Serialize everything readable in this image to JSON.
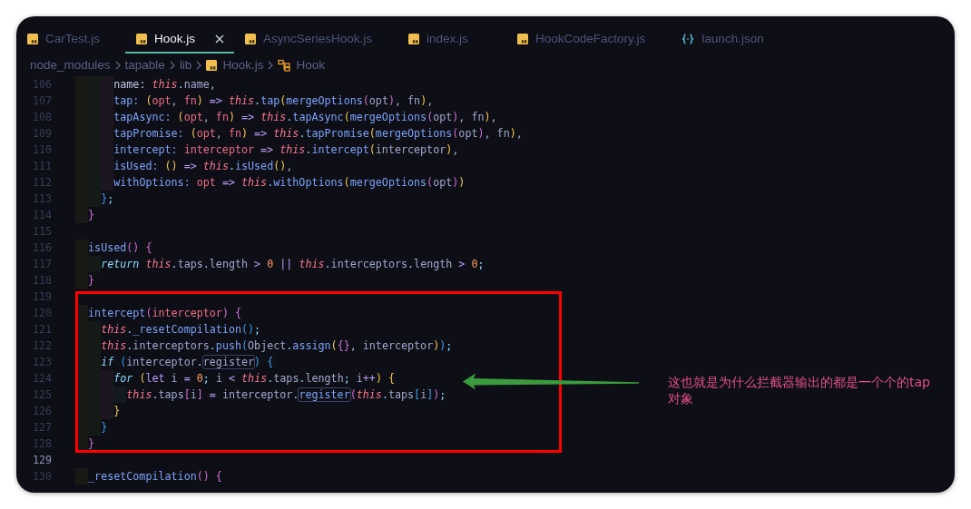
{
  "tabs": [
    {
      "label": "CarTest.js",
      "kind": "js",
      "selected": false
    },
    {
      "label": "Hook.js",
      "kind": "js",
      "selected": true
    },
    {
      "label": "AsyncSeriesHook.js",
      "kind": "js",
      "selected": false
    },
    {
      "label": "index.js",
      "kind": "js",
      "selected": false
    },
    {
      "label": "HookCodeFactory.js",
      "kind": "js",
      "selected": false
    },
    {
      "label": "launch.json",
      "kind": "json",
      "selected": false
    }
  ],
  "breadcrumb": [
    {
      "label": "node_modules",
      "kind": "folder"
    },
    {
      "label": "tapable",
      "kind": "folder"
    },
    {
      "label": "lib",
      "kind": "folder"
    },
    {
      "label": "Hook.js",
      "kind": "file"
    },
    {
      "label": "Hook",
      "kind": "symbol"
    }
  ],
  "editor": {
    "lines": [
      {
        "number": "106",
        "current": false,
        "tokens": [
          {
            "text": "      name: ",
            "kind": "key"
          },
          {
            "text": "this",
            "kind": "this"
          },
          {
            "text": ".",
            "kind": "punct"
          },
          {
            "text": "name,",
            "kind": "plain"
          }
        ]
      },
      {
        "number": "107",
        "current": false,
        "tokens": [
          {
            "text": "      tap: ",
            "kind": "func"
          },
          {
            "text": "(",
            "kind": "b1"
          },
          {
            "text": "opt",
            "kind": "param"
          },
          {
            "text": ", ",
            "kind": "plain"
          },
          {
            "text": "fn",
            "kind": "param"
          },
          {
            "text": ")",
            "kind": "b1"
          },
          {
            "text": " => ",
            "kind": "op"
          },
          {
            "text": "this",
            "kind": "this"
          },
          {
            "text": ".",
            "kind": "punct"
          },
          {
            "text": "tap",
            "kind": "func"
          },
          {
            "text": "(",
            "kind": "b1"
          },
          {
            "text": "mergeOptions",
            "kind": "func"
          },
          {
            "text": "(",
            "kind": "b2"
          },
          {
            "text": "opt",
            "kind": "plain"
          },
          {
            "text": ")",
            "kind": "b2"
          },
          {
            "text": ", fn",
            "kind": "plain"
          },
          {
            "text": ")",
            "kind": "b1"
          },
          {
            "text": ",",
            "kind": "plain"
          }
        ]
      },
      {
        "number": "108",
        "current": false,
        "tokens": [
          {
            "text": "      tapAsync: ",
            "kind": "func"
          },
          {
            "text": "(",
            "kind": "b1"
          },
          {
            "text": "opt",
            "kind": "param"
          },
          {
            "text": ", ",
            "kind": "plain"
          },
          {
            "text": "fn",
            "kind": "param"
          },
          {
            "text": ")",
            "kind": "b1"
          },
          {
            "text": " => ",
            "kind": "op"
          },
          {
            "text": "this",
            "kind": "this"
          },
          {
            "text": ".",
            "kind": "punct"
          },
          {
            "text": "tapAsync",
            "kind": "func"
          },
          {
            "text": "(",
            "kind": "b1"
          },
          {
            "text": "mergeOptions",
            "kind": "func"
          },
          {
            "text": "(",
            "kind": "b2"
          },
          {
            "text": "opt",
            "kind": "plain"
          },
          {
            "text": ")",
            "kind": "b2"
          },
          {
            "text": ", fn",
            "kind": "plain"
          },
          {
            "text": ")",
            "kind": "b1"
          },
          {
            "text": ",",
            "kind": "plain"
          }
        ]
      },
      {
        "number": "109",
        "current": false,
        "tokens": [
          {
            "text": "      tapPromise: ",
            "kind": "func"
          },
          {
            "text": "(",
            "kind": "b1"
          },
          {
            "text": "opt",
            "kind": "param"
          },
          {
            "text": ", ",
            "kind": "plain"
          },
          {
            "text": "fn",
            "kind": "param"
          },
          {
            "text": ")",
            "kind": "b1"
          },
          {
            "text": " => ",
            "kind": "op"
          },
          {
            "text": "this",
            "kind": "this"
          },
          {
            "text": ".",
            "kind": "punct"
          },
          {
            "text": "tapPromise",
            "kind": "func"
          },
          {
            "text": "(",
            "kind": "b1"
          },
          {
            "text": "mergeOptions",
            "kind": "func"
          },
          {
            "text": "(",
            "kind": "b2"
          },
          {
            "text": "opt",
            "kind": "plain"
          },
          {
            "text": ")",
            "kind": "b2"
          },
          {
            "text": ", fn",
            "kind": "plain"
          },
          {
            "text": ")",
            "kind": "b1"
          },
          {
            "text": ",",
            "kind": "plain"
          }
        ]
      },
      {
        "number": "110",
        "current": false,
        "tokens": [
          {
            "text": "      intercept: ",
            "kind": "func"
          },
          {
            "text": "interceptor",
            "kind": "param"
          },
          {
            "text": " => ",
            "kind": "op"
          },
          {
            "text": "this",
            "kind": "this"
          },
          {
            "text": ".",
            "kind": "punct"
          },
          {
            "text": "intercept",
            "kind": "func"
          },
          {
            "text": "(",
            "kind": "b1"
          },
          {
            "text": "interceptor",
            "kind": "plain"
          },
          {
            "text": ")",
            "kind": "b1"
          },
          {
            "text": ",",
            "kind": "plain"
          }
        ]
      },
      {
        "number": "111",
        "current": false,
        "tokens": [
          {
            "text": "      isUsed: ",
            "kind": "func"
          },
          {
            "text": "()",
            "kind": "b1"
          },
          {
            "text": " => ",
            "kind": "op"
          },
          {
            "text": "this",
            "kind": "this"
          },
          {
            "text": ".",
            "kind": "punct"
          },
          {
            "text": "isUsed",
            "kind": "func"
          },
          {
            "text": "()",
            "kind": "b1"
          },
          {
            "text": ",",
            "kind": "plain"
          }
        ]
      },
      {
        "number": "112",
        "current": false,
        "tokens": [
          {
            "text": "      withOptions: ",
            "kind": "func"
          },
          {
            "text": "opt",
            "kind": "param"
          },
          {
            "text": " => ",
            "kind": "op"
          },
          {
            "text": "this",
            "kind": "this"
          },
          {
            "text": ".",
            "kind": "punct"
          },
          {
            "text": "withOptions",
            "kind": "func"
          },
          {
            "text": "(",
            "kind": "b1"
          },
          {
            "text": "mergeOptions",
            "kind": "func"
          },
          {
            "text": "(",
            "kind": "b2"
          },
          {
            "text": "opt",
            "kind": "plain"
          },
          {
            "text": ")",
            "kind": "b2"
          },
          {
            "text": ")",
            "kind": "b1"
          }
        ]
      },
      {
        "number": "113",
        "current": false,
        "tokens": [
          {
            "text": "    }",
            "kind": "b3"
          },
          {
            "text": ";",
            "kind": "punct"
          }
        ]
      },
      {
        "number": "114",
        "current": false,
        "tokens": [
          {
            "text": "  }",
            "kind": "b2"
          }
        ]
      },
      {
        "number": "115",
        "current": false
      },
      {
        "number": "116",
        "current": false,
        "tokens": [
          {
            "text": "  isUsed",
            "kind": "func"
          },
          {
            "text": "() {",
            "kind": "b2"
          }
        ]
      },
      {
        "number": "117",
        "current": false,
        "tokens": [
          {
            "text": "    return ",
            "kind": "kw"
          },
          {
            "text": "this",
            "kind": "this"
          },
          {
            "text": ".",
            "kind": "punct"
          },
          {
            "text": "taps",
            "kind": "plain"
          },
          {
            "text": ".",
            "kind": "punct"
          },
          {
            "text": "length",
            "kind": "plain"
          },
          {
            "text": " > ",
            "kind": "op"
          },
          {
            "text": "0",
            "kind": "num"
          },
          {
            "text": " || ",
            "kind": "op"
          },
          {
            "text": "this",
            "kind": "this"
          },
          {
            "text": ".",
            "kind": "punct"
          },
          {
            "text": "interceptors",
            "kind": "plain"
          },
          {
            "text": ".",
            "kind": "punct"
          },
          {
            "text": "length",
            "kind": "plain"
          },
          {
            "text": " > ",
            "kind": "op"
          },
          {
            "text": "0",
            "kind": "num"
          },
          {
            "text": ";",
            "kind": "punct"
          }
        ]
      },
      {
        "number": "118",
        "current": false,
        "tokens": [
          {
            "text": "  }",
            "kind": "b2"
          }
        ]
      },
      {
        "number": "119",
        "current": false
      },
      {
        "number": "120",
        "current": false,
        "tokens": [
          {
            "text": "  intercept",
            "kind": "func"
          },
          {
            "text": "(",
            "kind": "b2"
          },
          {
            "text": "interceptor",
            "kind": "param"
          },
          {
            "text": ") {",
            "kind": "b2"
          }
        ]
      },
      {
        "number": "121",
        "current": false,
        "tokens": [
          {
            "text": "    this",
            "kind": "this"
          },
          {
            "text": ".",
            "kind": "punct"
          },
          {
            "text": "_resetCompilation",
            "kind": "func"
          },
          {
            "text": "()",
            "kind": "b3"
          },
          {
            "text": ";",
            "kind": "punct"
          }
        ]
      },
      {
        "number": "122",
        "current": false,
        "tokens": [
          {
            "text": "    this",
            "kind": "this"
          },
          {
            "text": ".",
            "kind": "punct"
          },
          {
            "text": "interceptors",
            "kind": "plain"
          },
          {
            "text": ".",
            "kind": "punct"
          },
          {
            "text": "push",
            "kind": "func"
          },
          {
            "text": "(",
            "kind": "b3"
          },
          {
            "text": "Object",
            "kind": "plain"
          },
          {
            "text": ".",
            "kind": "punct"
          },
          {
            "text": "assign",
            "kind": "func"
          },
          {
            "text": "(",
            "kind": "b1"
          },
          {
            "text": "{}",
            "kind": "b2"
          },
          {
            "text": ", interceptor",
            "kind": "plain"
          },
          {
            "text": ")",
            "kind": "b1"
          },
          {
            "text": ")",
            "kind": "b3"
          },
          {
            "text": ";",
            "kind": "punct"
          }
        ]
      },
      {
        "number": "123",
        "current": false,
        "tokens": [
          {
            "text": "    if ",
            "kind": "kw"
          },
          {
            "text": "(",
            "kind": "b3"
          },
          {
            "text": "interceptor",
            "kind": "plain"
          },
          {
            "text": ".",
            "kind": "punct"
          },
          {
            "text": "register",
            "kind": "match_plain"
          },
          {
            "text": ") {",
            "kind": "b3"
          }
        ]
      },
      {
        "number": "124",
        "current": false,
        "tokens": [
          {
            "text": "      for ",
            "kind": "kw"
          },
          {
            "text": "(",
            "kind": "b1"
          },
          {
            "text": "let",
            "kind": "storage"
          },
          {
            "text": " i",
            "kind": "plain"
          },
          {
            "text": " = ",
            "kind": "op"
          },
          {
            "text": "0",
            "kind": "num"
          },
          {
            "text": ";",
            "kind": "punct"
          },
          {
            "text": " i",
            "kind": "plain"
          },
          {
            "text": " < ",
            "kind": "op"
          },
          {
            "text": "this",
            "kind": "this"
          },
          {
            "text": ".",
            "kind": "punct"
          },
          {
            "text": "taps",
            "kind": "plain"
          },
          {
            "text": ".",
            "kind": "punct"
          },
          {
            "text": "length",
            "kind": "plain"
          },
          {
            "text": ";",
            "kind": "punct"
          },
          {
            "text": " i",
            "kind": "plain"
          },
          {
            "text": "++",
            "kind": "op"
          },
          {
            "text": ") {",
            "kind": "b1"
          }
        ]
      },
      {
        "number": "125",
        "current": false,
        "tokens": [
          {
            "text": "        this",
            "kind": "this"
          },
          {
            "text": ".",
            "kind": "punct"
          },
          {
            "text": "taps",
            "kind": "plain"
          },
          {
            "text": "[",
            "kind": "b2"
          },
          {
            "text": "i",
            "kind": "plain"
          },
          {
            "text": "]",
            "kind": "b2"
          },
          {
            "text": " = ",
            "kind": "op"
          },
          {
            "text": "interceptor",
            "kind": "plain"
          },
          {
            "text": ".",
            "kind": "punct"
          },
          {
            "text": "register",
            "kind": "match_func"
          },
          {
            "text": "(",
            "kind": "b2"
          },
          {
            "text": "this",
            "kind": "this"
          },
          {
            "text": ".",
            "kind": "punct"
          },
          {
            "text": "taps",
            "kind": "plain"
          },
          {
            "text": "[",
            "kind": "b3"
          },
          {
            "text": "i",
            "kind": "plain"
          },
          {
            "text": "]",
            "kind": "b3"
          },
          {
            "text": ")",
            "kind": "b2"
          },
          {
            "text": ";",
            "kind": "punct"
          }
        ]
      },
      {
        "number": "126",
        "current": false,
        "tokens": [
          {
            "text": "      }",
            "kind": "b1"
          }
        ]
      },
      {
        "number": "127",
        "current": false,
        "tokens": [
          {
            "text": "    }",
            "kind": "b3"
          }
        ]
      },
      {
        "number": "128",
        "current": false,
        "tokens": [
          {
            "text": "  }",
            "kind": "b2"
          }
        ]
      },
      {
        "number": "129",
        "current": true
      },
      {
        "number": "130",
        "current": false,
        "tokens": [
          {
            "text": "  _resetCompilation",
            "kind": "func"
          },
          {
            "text": "() {",
            "kind": "b2"
          }
        ]
      }
    ]
  },
  "annotation": {
    "note": "这也就是为什么拦截器输出的都是一个个的tap对象"
  }
}
